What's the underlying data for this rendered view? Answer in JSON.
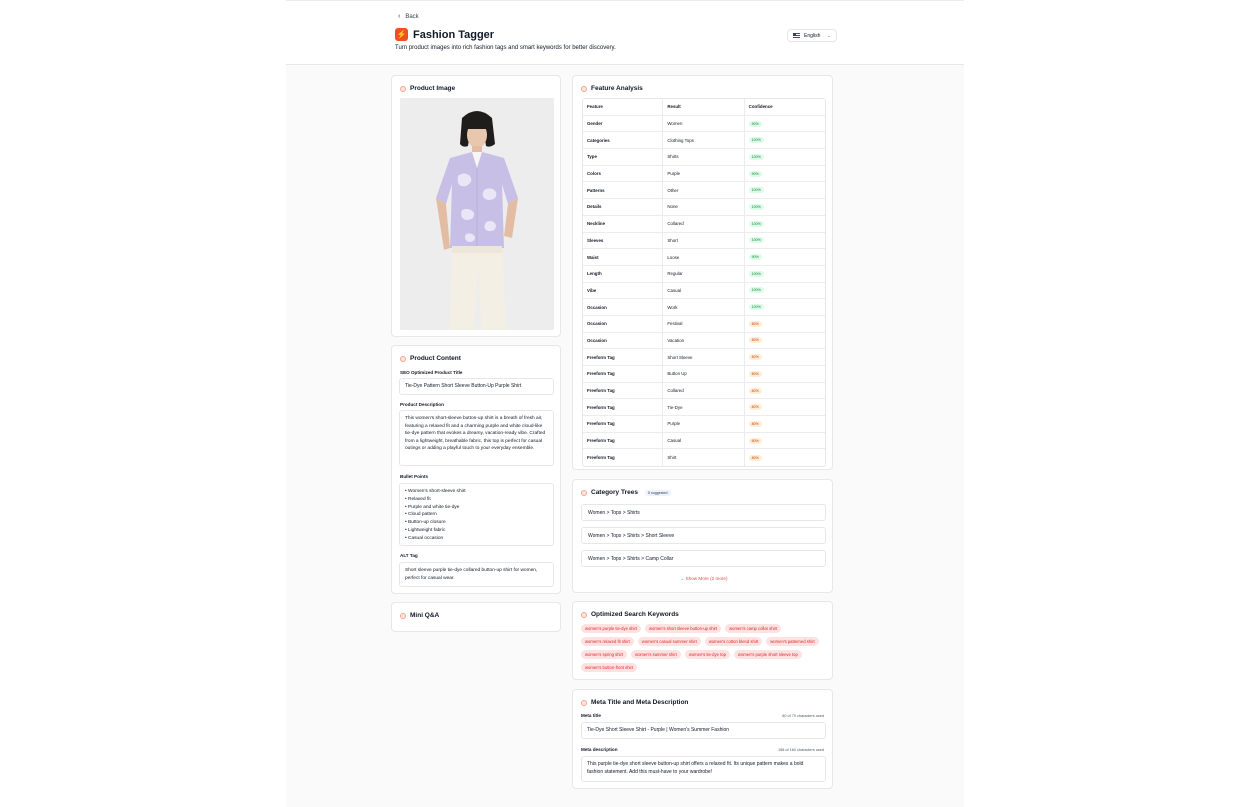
{
  "header": {
    "back_label": "Back",
    "app_title": "Fashion Tagger",
    "subtitle": "Turn product images into rich fashion tags and smart keywords for better discovery.",
    "language": "English"
  },
  "product_image": {
    "title": "Product Image"
  },
  "product_content": {
    "title": "Product Content",
    "seo_label": "SEO Optimized Product Title",
    "seo_value": "Tie-Dye Pattern Short Sleeve Button-Up Purple Shirt",
    "desc_label": "Product Description",
    "desc_value": "This women's short-sleeve button-up shirt is a breath of fresh air, featuring a relaxed fit and a charming purple and white cloud-like tie-dye pattern that evokes a dreamy, vacation-ready vibe. Crafted from a lightweight, breathable fabric, this top is perfect for casual outings or adding a playful touch to your everyday ensemble.",
    "bullets_label": "Bullet Points",
    "bullets": [
      "• Women's short-sleeve shirt",
      "• Relaxed fit",
      "• Purple and white tie-dye",
      "• Cloud pattern",
      "• Button-up closure",
      "• Lightweight fabric",
      "• Casual occasion"
    ],
    "alt_label": "ALT Tag",
    "alt_value": "Short sleeve purple tie-dye collared button-up shirt for women, perfect for casual wear."
  },
  "mini_qa": {
    "title": "Mini Q&A"
  },
  "feature_analysis": {
    "title": "Feature Analysis",
    "headers": [
      "Feature",
      "Result",
      "Confidence"
    ],
    "rows": [
      {
        "feature": "Gender",
        "result": "Women",
        "confidence": "90%",
        "level": "hi"
      },
      {
        "feature": "Categories",
        "result": "Clothing Tops",
        "confidence": "100%",
        "level": "hi"
      },
      {
        "feature": "Type",
        "result": "Shirts",
        "confidence": "100%",
        "level": "hi"
      },
      {
        "feature": "Colors",
        "result": "Purple",
        "confidence": "90%",
        "level": "hi"
      },
      {
        "feature": "Patterns",
        "result": "Other",
        "confidence": "100%",
        "level": "hi"
      },
      {
        "feature": "Details",
        "result": "None",
        "confidence": "100%",
        "level": "hi"
      },
      {
        "feature": "Neckline",
        "result": "Collared",
        "confidence": "100%",
        "level": "hi"
      },
      {
        "feature": "Sleeves",
        "result": "Short",
        "confidence": "100%",
        "level": "hi"
      },
      {
        "feature": "Waist",
        "result": "Loose",
        "confidence": "90%",
        "level": "hi"
      },
      {
        "feature": "Length",
        "result": "Regular",
        "confidence": "100%",
        "level": "hi"
      },
      {
        "feature": "Vibe",
        "result": "Casual",
        "confidence": "100%",
        "level": "hi"
      },
      {
        "feature": "Occasion",
        "result": "Work",
        "confidence": "100%",
        "level": "hi"
      },
      {
        "feature": "Occasion",
        "result": "Festival",
        "confidence": "80%",
        "level": "lo"
      },
      {
        "feature": "Occasion",
        "result": "Vacation",
        "confidence": "80%",
        "level": "lo"
      },
      {
        "feature": "Freeform Tag",
        "result": "Short Sleeve",
        "confidence": "80%",
        "level": "lo"
      },
      {
        "feature": "Freeform Tag",
        "result": "Button Up",
        "confidence": "80%",
        "level": "lo"
      },
      {
        "feature": "Freeform Tag",
        "result": "Collared",
        "confidence": "80%",
        "level": "lo"
      },
      {
        "feature": "Freeform Tag",
        "result": "Tie-Dye",
        "confidence": "80%",
        "level": "lo"
      },
      {
        "feature": "Freeform Tag",
        "result": "Purple",
        "confidence": "80%",
        "level": "lo"
      },
      {
        "feature": "Freeform Tag",
        "result": "Casual",
        "confidence": "80%",
        "level": "lo"
      },
      {
        "feature": "Freeform Tag",
        "result": "Shirt",
        "confidence": "80%",
        "level": "lo"
      }
    ]
  },
  "category_trees": {
    "title": "Category Trees",
    "badge": "5 suggested",
    "items": [
      "Women > Tops > Shirts",
      "Women > Tops > Shirts > Short Sleeve",
      "Women > Tops > Shirts > Camp Collar"
    ],
    "show_more": "Show More (2 more)"
  },
  "keywords": {
    "title": "Optimized Search Keywords",
    "items": [
      "women's purple tie-dye shirt",
      "women's short sleeve button-up shirt",
      "women's camp collar shirt",
      "women's relaxed fit shirt",
      "women's casual summer shirt",
      "women's cotton blend shirt",
      "women's patterned shirt",
      "women's spring shirt",
      "women's summer shirt",
      "women's tie-dye top",
      "women's purple short sleeve top",
      "women's button-front shirt"
    ]
  },
  "meta": {
    "title": "Meta Title and Meta Description",
    "title_label": "Meta title",
    "title_count": "60 of 70 characters used",
    "title_value": "Tie-Dye Short Sleeve Shirt - Purple | Women's Summer Fashion",
    "desc_label": "Meta description",
    "desc_count": "158 of 160 characters used",
    "desc_value": "This purple tie-dye short sleeve button-up shirt offers a relaxed fit. Its unique pattern makes a bold fashion statement. Add this must-have to your wardrobe!"
  },
  "colors": {
    "accent": "#f04e23",
    "high_conf": "#dcfce7",
    "low_conf": "#ffedd5",
    "keyword_bg": "#fee2e2"
  }
}
